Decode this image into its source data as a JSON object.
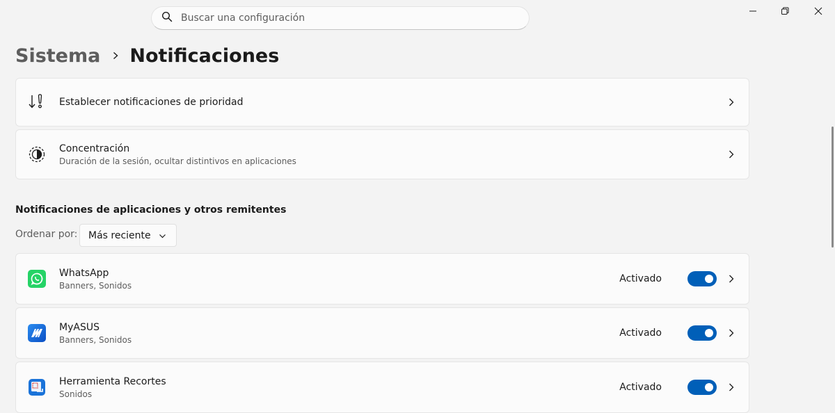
{
  "search": {
    "placeholder": "Buscar una configuración"
  },
  "breadcrumb": {
    "parent": "Sistema",
    "current": "Notificaciones"
  },
  "priority": {
    "title": "Establecer notificaciones de prioridad"
  },
  "focus": {
    "title": "Concentración",
    "subtitle": "Duración de la sesión, ocultar distintivos en aplicaciones"
  },
  "apps_section": {
    "title": "Notificaciones de aplicaciones y otros remitentes",
    "sort_label": "Ordenar por:",
    "sort_value": "Más reciente"
  },
  "apps": [
    {
      "name": "WhatsApp",
      "detail": "Banners, Sonidos",
      "state": "Activado",
      "enabled": true
    },
    {
      "name": "MyASUS",
      "detail": "Banners, Sonidos",
      "state": "Activado",
      "enabled": true
    },
    {
      "name": "Herramienta Recortes",
      "detail": "Sonidos",
      "state": "Activado",
      "enabled": true
    }
  ],
  "colors": {
    "accent": "#005fb8",
    "whatsapp": "#25d366",
    "myasus": "#1565d8"
  }
}
